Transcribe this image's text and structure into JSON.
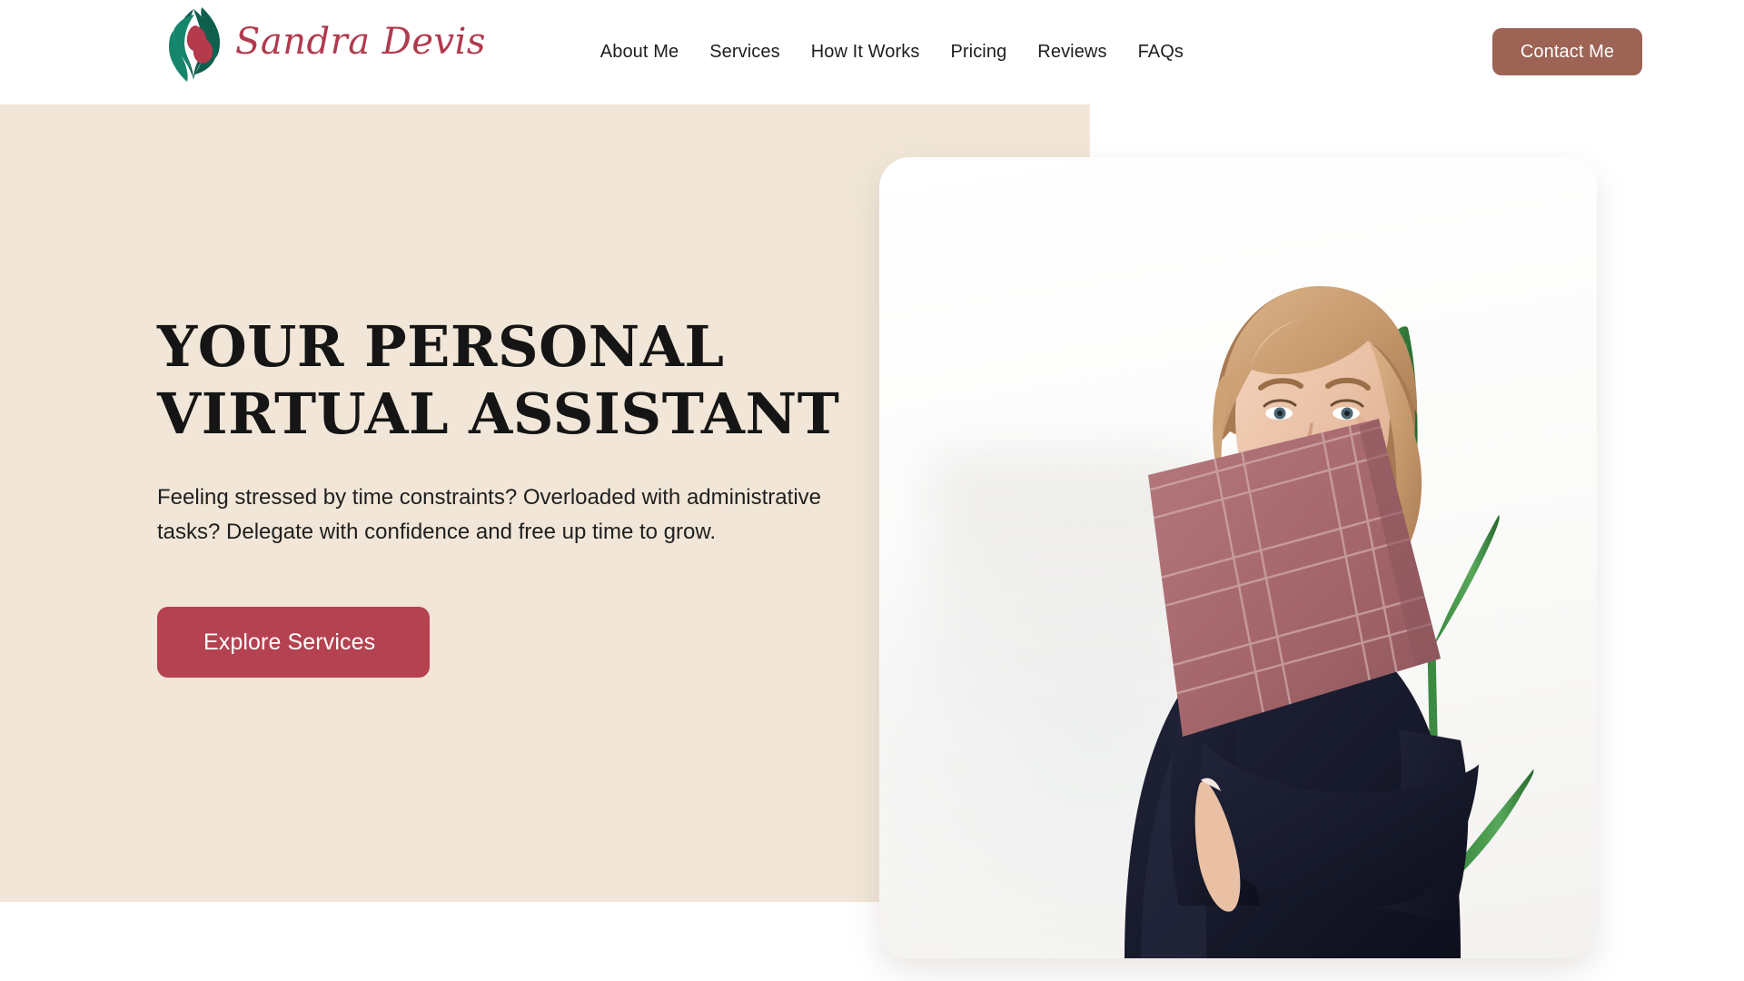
{
  "brand": {
    "name": "Sandra Devis",
    "logo_icon": "interlocking-leaf-logo",
    "logo_colors": {
      "green": "#0f5f4e",
      "teal": "#16856c",
      "red": "#b43a4c"
    }
  },
  "nav": {
    "items": [
      {
        "label": "About Me"
      },
      {
        "label": "Services"
      },
      {
        "label": "How It Works"
      },
      {
        "label": "Pricing"
      },
      {
        "label": "Reviews"
      },
      {
        "label": "FAQs"
      }
    ],
    "cta": {
      "label": "Contact Me",
      "color": "#9d6354"
    }
  },
  "hero": {
    "title_line1": "YOUR PERSONAL",
    "title_line2": "VIRTUAL ASSISTANT",
    "subtitle": "Feeling stressed by time constraints? Overloaded with administrative tasks?  Delegate with confidence and free up time to grow.",
    "cta": {
      "label": "Explore Services",
      "color": "#b44250"
    },
    "panel_color": "#f1e6d7",
    "image": {
      "alt": "smiling-woman-holding-folder",
      "subject_top_color": "#1b1d2b",
      "folder_color": "#a8666a",
      "hair_color": "#c69a72",
      "plant_color": "#3f8f45",
      "card_color": "#ffffff"
    }
  }
}
